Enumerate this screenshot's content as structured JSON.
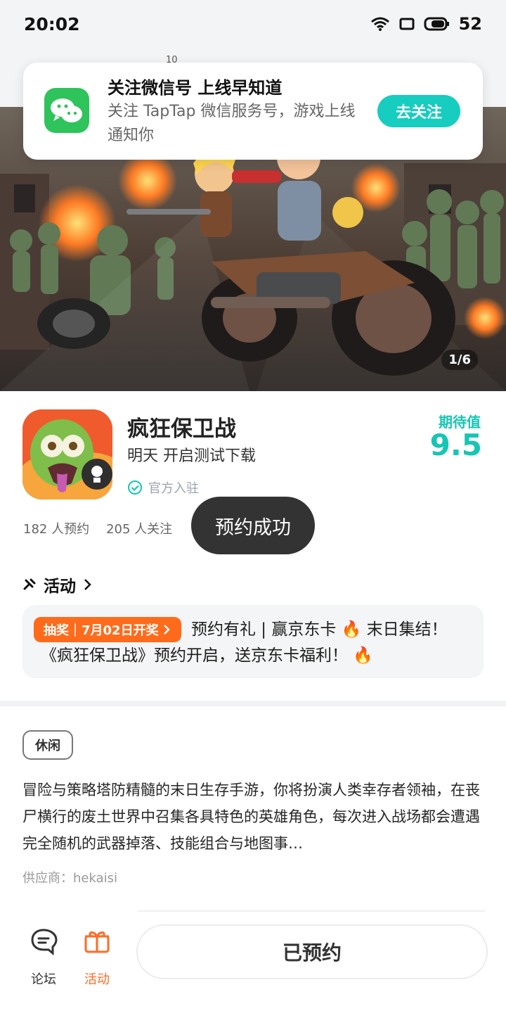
{
  "status_bar": {
    "time": "20:02",
    "battery": "52"
  },
  "background_overlap_text": "10",
  "notification": {
    "title": "关注微信号 上线早知道",
    "description": "关注 TapTap 微信服务号，游戏上线通知你",
    "button": "去关注",
    "icon": "wechat-icon"
  },
  "hero": {
    "counter": "1/6"
  },
  "app": {
    "title": "疯狂保卫战",
    "subtitle": "明天 开启测试下载",
    "official": "官方入驻",
    "rating_label": "期待值",
    "rating_value": "9.5",
    "stats": {
      "reservations": "182 人预约",
      "followers": "205 人关注"
    },
    "success_toast": "预约成功"
  },
  "activity": {
    "header": "活动",
    "badge": "抽奖｜7月02日开奖",
    "line1": "预约有礼 | 赢京东卡 🔥 末日集结！",
    "line2": "《疯狂保卫战》预约开启，送京东卡福利！ 🔥"
  },
  "description": {
    "tag": "休闲",
    "text": "冒险与策略塔防精髓的末日生存手游，你将扮演人类幸存者领袖，在丧尸横行的废土世界中召集各具特色的英雄角色，每次进入战场都会遭遇完全随机的武器掉落、技能组合与地图事…",
    "supplier": "供应商：hekaisi"
  },
  "bottom_nav": {
    "forum": "论坛",
    "activity": "活动",
    "reserve_button": "已预约"
  },
  "colors": {
    "accent": "#16cdbf",
    "orange": "#ff6b1b",
    "wechat": "#2fc35b"
  }
}
